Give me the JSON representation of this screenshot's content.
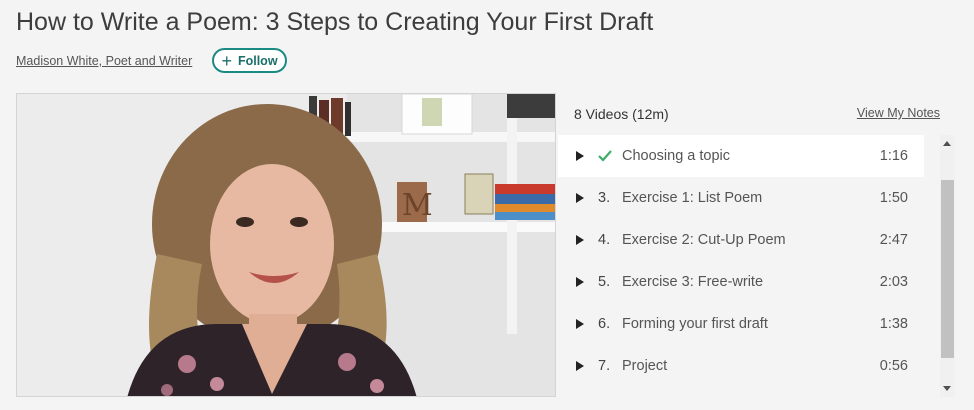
{
  "class": {
    "title": "How to Write a Poem: 3 Steps to Creating Your First Draft",
    "teacher": "Madison White, Poet and Writer",
    "follow_label": "Follow"
  },
  "playlist": {
    "count_label": "8 Videos (12m)",
    "notes_label": "View My Notes",
    "items": [
      {
        "number": "",
        "label": "Choosing a topic",
        "duration": "1:16",
        "completed": true,
        "active": true
      },
      {
        "number": "3.",
        "label": "Exercise 1: List Poem",
        "duration": "1:50"
      },
      {
        "number": "4.",
        "label": "Exercise 2: Cut-Up Poem",
        "duration": "2:47"
      },
      {
        "number": "5.",
        "label": "Exercise 3: Free-write",
        "duration": "2:03"
      },
      {
        "number": "6.",
        "label": "Forming your first draft",
        "duration": "1:38"
      },
      {
        "number": "7.",
        "label": "Project",
        "duration": "0:56"
      }
    ]
  },
  "colors": {
    "accent": "#1b8a85",
    "check": "#3fae6a"
  },
  "icons": {
    "play": "play-icon",
    "check": "check-icon",
    "plus": "plus-icon"
  }
}
